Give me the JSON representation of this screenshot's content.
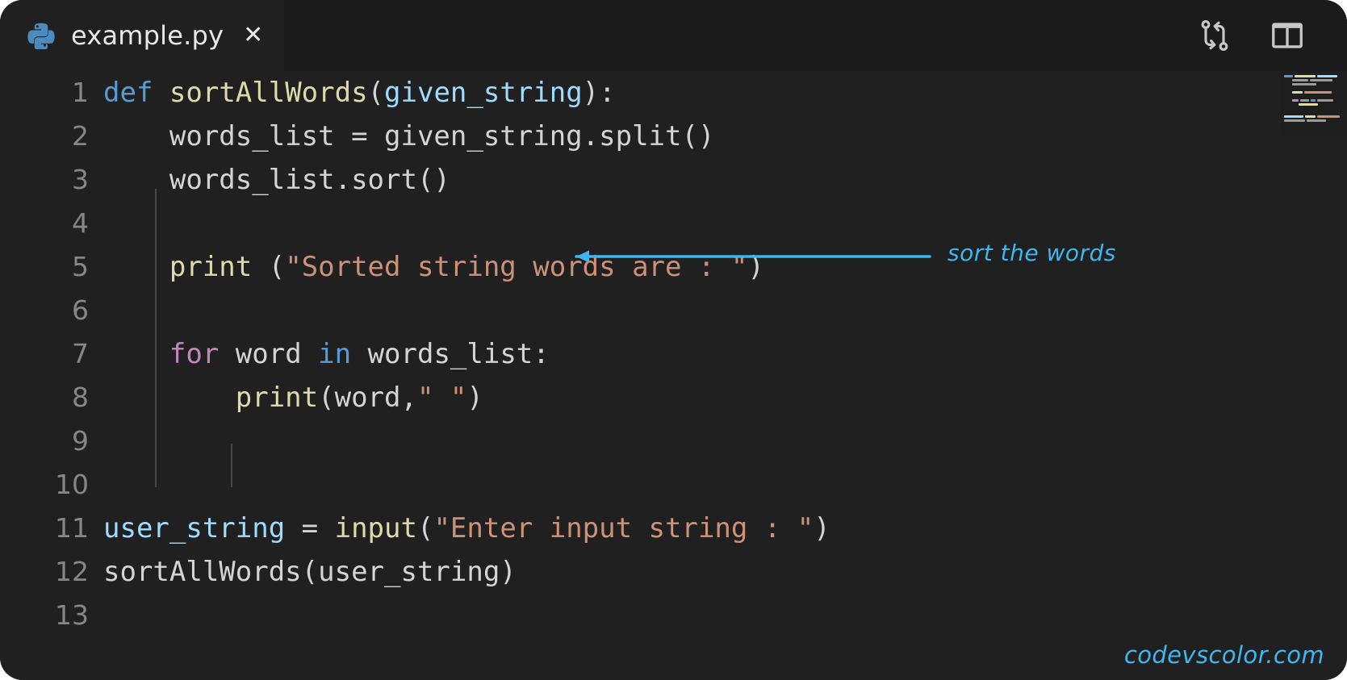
{
  "window": {
    "background": "#202020",
    "tabbar_background": "#1b1b1b"
  },
  "tab": {
    "icon": "python-logo-icon",
    "filename": "example.py",
    "close_label": "✕"
  },
  "actions": [
    {
      "name": "compare-changes-icon",
      "label": "Compare Changes"
    },
    {
      "name": "split-editor-icon",
      "label": "Split Editor"
    }
  ],
  "editor": {
    "language": "python",
    "line_numbers": [
      "1",
      "2",
      "3",
      "4",
      "5",
      "6",
      "7",
      "8",
      "9",
      "10",
      "11",
      "12",
      "13"
    ],
    "colors": {
      "keyword": "#569cd6",
      "control_keyword": "#c586c0",
      "function": "#dcdcaa",
      "variable": "#9cdcfe",
      "plain": "#d4d4d4",
      "string": "#ce9178",
      "line_number": "#868686",
      "indent_guide": "#484848",
      "annotation": "#3fb6ef"
    },
    "lines": [
      {
        "num": "1",
        "tokens": [
          {
            "t": "def",
            "c": "kw"
          },
          {
            "t": " ",
            "c": "plain"
          },
          {
            "t": "sortAllWords",
            "c": "fn"
          },
          {
            "t": "(",
            "c": "punct"
          },
          {
            "t": "given_string",
            "c": "param"
          },
          {
            "t": "):",
            "c": "punct"
          }
        ]
      },
      {
        "num": "2",
        "tokens": [
          {
            "t": "    ",
            "c": "plain"
          },
          {
            "t": "words_list",
            "c": "plain"
          },
          {
            "t": " = ",
            "c": "plain"
          },
          {
            "t": "given_string",
            "c": "plain"
          },
          {
            "t": ".split()",
            "c": "plain"
          }
        ]
      },
      {
        "num": "3",
        "tokens": [
          {
            "t": "    ",
            "c": "plain"
          },
          {
            "t": "words_list",
            "c": "plain"
          },
          {
            "t": ".sort()",
            "c": "plain"
          }
        ]
      },
      {
        "num": "4",
        "tokens": []
      },
      {
        "num": "5",
        "tokens": [
          {
            "t": "    ",
            "c": "plain"
          },
          {
            "t": "print",
            "c": "fn"
          },
          {
            "t": " (",
            "c": "punct"
          },
          {
            "t": "\"Sorted string words are : \"",
            "c": "str"
          },
          {
            "t": ")",
            "c": "punct"
          }
        ]
      },
      {
        "num": "6",
        "tokens": []
      },
      {
        "num": "7",
        "tokens": [
          {
            "t": "    ",
            "c": "plain"
          },
          {
            "t": "for",
            "c": "kwc"
          },
          {
            "t": " word ",
            "c": "plain"
          },
          {
            "t": "in",
            "c": "kw"
          },
          {
            "t": " words_list:",
            "c": "plain"
          }
        ]
      },
      {
        "num": "8",
        "tokens": [
          {
            "t": "        ",
            "c": "plain"
          },
          {
            "t": "print",
            "c": "fn"
          },
          {
            "t": "(",
            "c": "punct"
          },
          {
            "t": "word",
            "c": "plain"
          },
          {
            "t": ",",
            "c": "punct"
          },
          {
            "t": "\" \"",
            "c": "str"
          },
          {
            "t": ")",
            "c": "punct"
          }
        ]
      },
      {
        "num": "9",
        "tokens": []
      },
      {
        "num": "10",
        "tokens": []
      },
      {
        "num": "11",
        "tokens": [
          {
            "t": "user_string",
            "c": "var"
          },
          {
            "t": " = ",
            "c": "plain"
          },
          {
            "t": "input",
            "c": "fn"
          },
          {
            "t": "(",
            "c": "punct"
          },
          {
            "t": "\"Enter input string : \"",
            "c": "str"
          },
          {
            "t": ")",
            "c": "punct"
          }
        ]
      },
      {
        "num": "12",
        "tokens": [
          {
            "t": "sortAllWords",
            "c": "plain"
          },
          {
            "t": "(",
            "c": "punct"
          },
          {
            "t": "user_string",
            "c": "plain"
          },
          {
            "t": ")",
            "c": "punct"
          }
        ]
      },
      {
        "num": "13",
        "tokens": []
      }
    ]
  },
  "annotation": {
    "text": "sort the words",
    "color": "#3fb6ef",
    "arrow_direction": "left",
    "points_to_line": "3"
  },
  "minimap": {
    "name": "code-minimap"
  },
  "watermark": {
    "text": "codevscolor.com",
    "color": "#3fb6ef"
  }
}
